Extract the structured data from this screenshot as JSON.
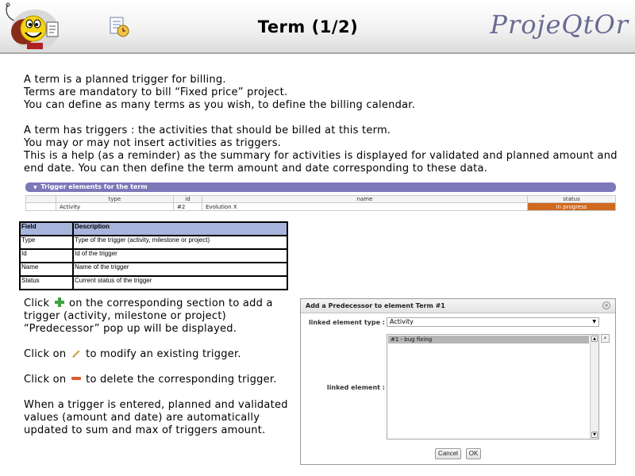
{
  "header": {
    "title": "Term (1/2)",
    "brand": "ProjeQtOr"
  },
  "intro": [
    "A term is a planned trigger for billing.",
    "Terms are mandatory to bill “Fixed price” project.",
    "You can define as many terms as you wish, to define the billing calendar."
  ],
  "triggers_text": [
    "A term has triggers : the activities that should be billed at this term.",
    "You may or may not insert activities as triggers.",
    "This is a help (as a reminder) as the summary for activities is displayed for validated and planned amount and",
    "end date. You can then define the term amount and date corresponding to these data."
  ],
  "trigger_section": {
    "title": "Trigger elements for the term",
    "columns": [
      "type",
      "id",
      "name",
      "status"
    ],
    "rows": [
      {
        "type": "Activity",
        "id": "#2",
        "name": "Evolution X",
        "status": "in progress"
      }
    ],
    "status_color": "#d0681f"
  },
  "field_table": {
    "headers": [
      "Field",
      "Description"
    ],
    "rows": [
      {
        "field": "Type",
        "description": "Type of the trigger  (activity, milestone or project)"
      },
      {
        "field": "Id",
        "description": "Id of the trigger"
      },
      {
        "field": "Name",
        "description": "Name of the trigger"
      },
      {
        "field": "Status",
        "description": "Current status of the trigger"
      }
    ]
  },
  "instructions": {
    "add": [
      "Click",
      "on the corresponding section to add a",
      "trigger (activity, milestone or project)",
      "“Predecessor” pop up will be displayed."
    ],
    "modify": [
      "Click on",
      "to modify an existing trigger."
    ],
    "delete": [
      "Click on",
      "to delete the corresponding trigger."
    ],
    "note": [
      "When a trigger is entered, planned and validated",
      "values (amount and date) are automatically",
      "updated to sum and max of triggers amount."
    ]
  },
  "dialog": {
    "title": "Add a Predecessor to element Term #1",
    "type_label": "linked element type :",
    "type_value": "Activity",
    "element_label": "linked element :",
    "options": [
      "#1 - bug fixing"
    ],
    "cancel": "Cancel",
    "ok": "OK"
  }
}
